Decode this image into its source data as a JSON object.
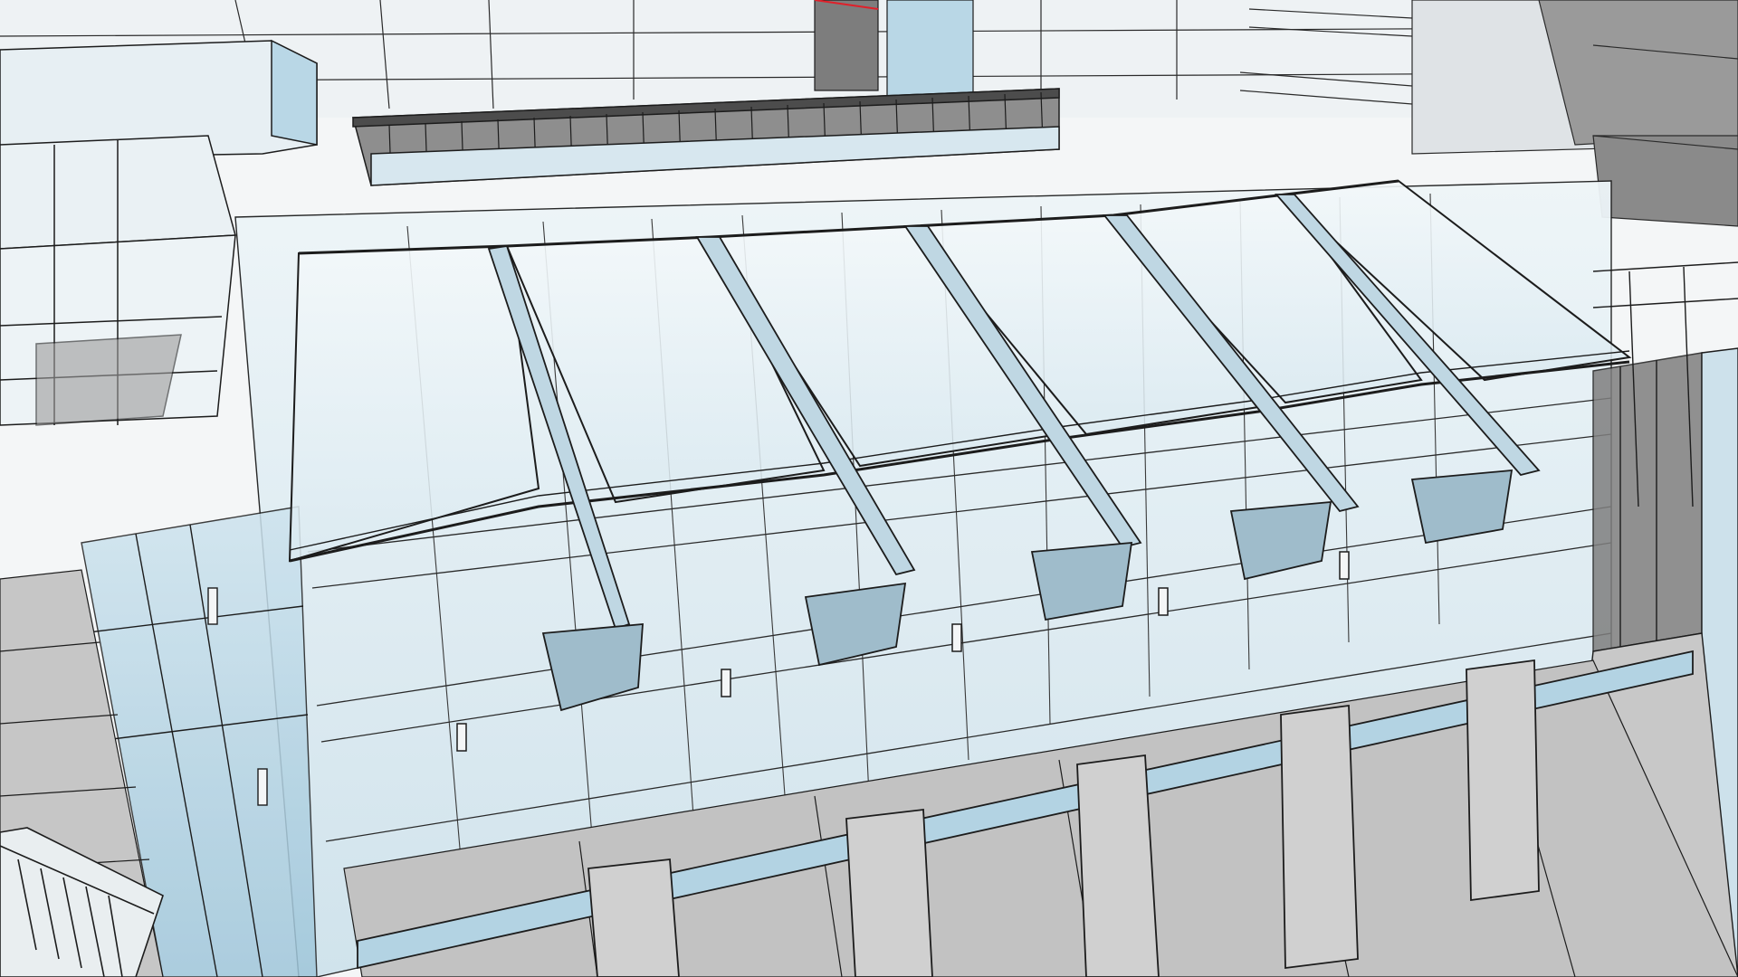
{
  "scene": {
    "subject": "architectural-wireframe-render",
    "colors": {
      "background": "#f4f6f7",
      "line": "#1c1c1c",
      "glass_light": "#e6f1f6",
      "glass_blue": "#b9d7e6",
      "floor_gray": "#c2c2c2",
      "shadow_gray": "#8d8d8d",
      "accent_red": "#e0202a"
    }
  }
}
